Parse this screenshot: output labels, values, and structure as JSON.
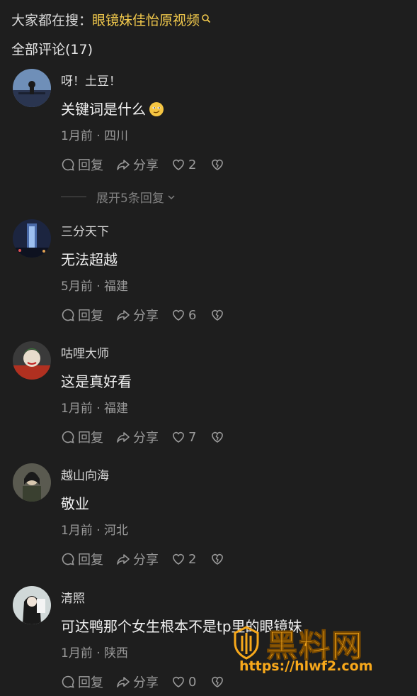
{
  "search": {
    "prefix": "大家都在搜：",
    "term": "眼镜妹佳怡原视频"
  },
  "all_comments_label": "全部评论(17)",
  "actions": {
    "reply": "回复",
    "share": "分享"
  },
  "comments": [
    {
      "user": "呀！土豆！",
      "text": "关键词是什么",
      "time": "1月前 · 四川",
      "likes": "2",
      "expand": "展开5条回复"
    },
    {
      "user": "三分天下",
      "text": "无法超越",
      "time": "5月前 · 福建",
      "likes": "6"
    },
    {
      "user": "咕哩大师",
      "text": "这是真好看",
      "time": "1月前 · 福建",
      "likes": "7"
    },
    {
      "user": "越山向海",
      "text": "敬业",
      "time": "1月前 · 河北",
      "likes": "2"
    },
    {
      "user": "清照",
      "text": "可达鸭那个女生根本不是tp里的眼镜妹",
      "time": "1月前 · 陕西",
      "likes": "0"
    }
  ],
  "watermark": {
    "title": "黑料网",
    "url": "https://hlwf2.com"
  },
  "colors": {
    "background": "#1e1e1e",
    "search_highlight": "#f2c94c",
    "watermark": "#f7a81b"
  }
}
